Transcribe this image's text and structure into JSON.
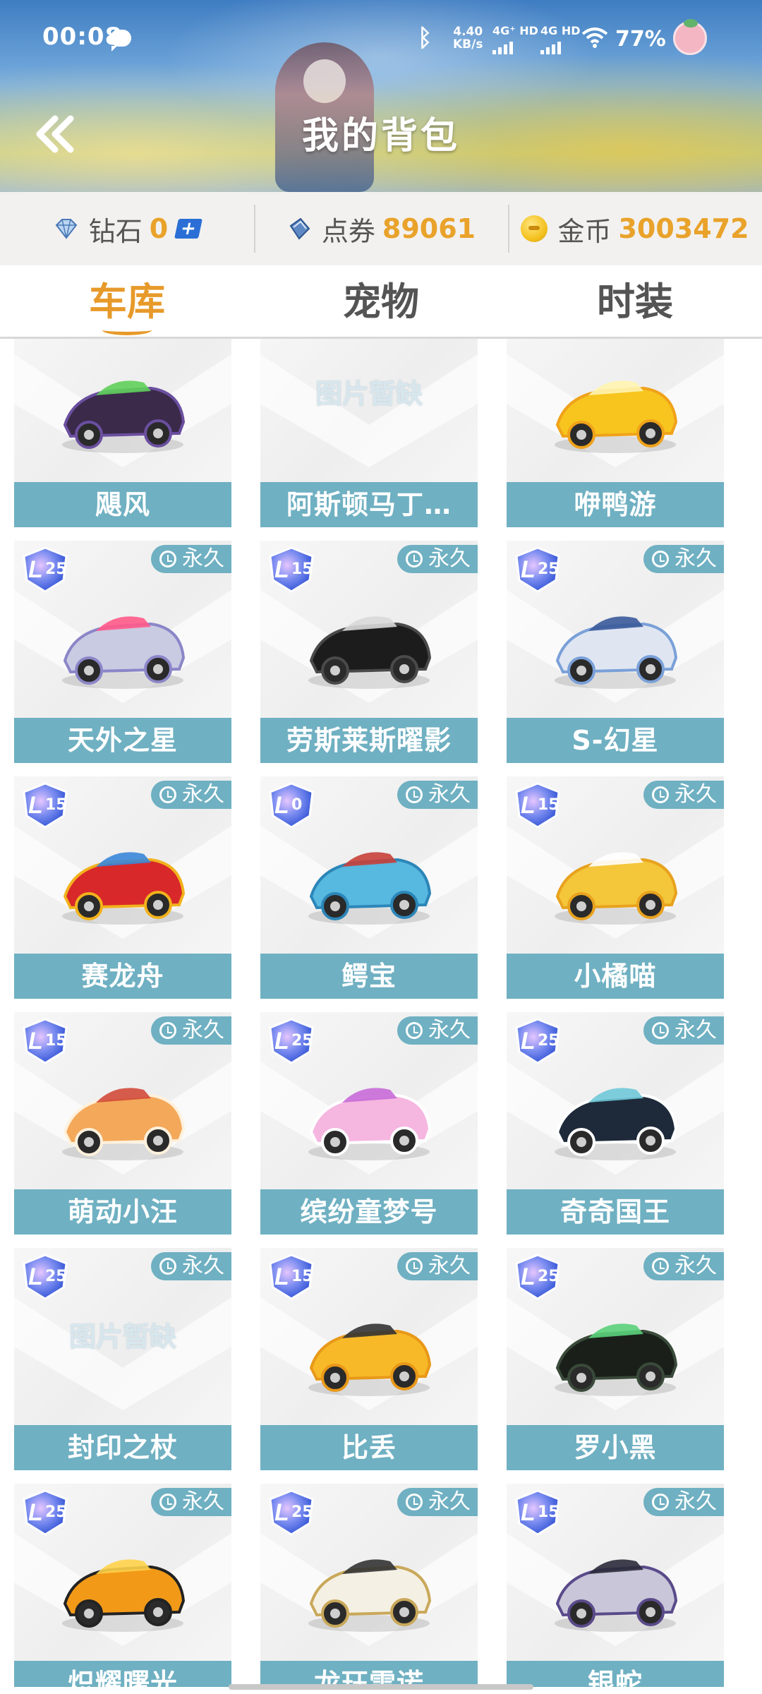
{
  "status_bar": {
    "time": "00:08",
    "net_speed_value": "4.40",
    "net_speed_unit": "KB/s",
    "sim1_label": "4G⁺ HD",
    "sim2_label": "4G HD",
    "battery": "77%"
  },
  "header": {
    "title": "我的背包"
  },
  "currency": {
    "diamond_label": "钻石",
    "diamond_value": "0",
    "voucher_label": "点券",
    "voucher_value": "89061",
    "coin_label": "金币",
    "coin_value": "3003472"
  },
  "tabs": [
    {
      "label": "车库",
      "active": true
    },
    {
      "label": "宠物",
      "active": false
    },
    {
      "label": "时装",
      "active": false
    }
  ],
  "accent_colors": {
    "tab_active": "#e79a2a",
    "card_label_bg": "#6fb0c2",
    "currency_value": "#e9a22a"
  },
  "items": [
    {
      "name": "飓风",
      "level": "",
      "tag": "",
      "image": "purple-green-kart",
      "missing_text": ""
    },
    {
      "name": "阿斯顿马丁…",
      "level": "",
      "tag": "",
      "image": "",
      "missing_text": "图片暂缺"
    },
    {
      "name": "咿鸭游",
      "level": "",
      "tag": "",
      "image": "yellow-duck-kart",
      "missing_text": ""
    },
    {
      "name": "天外之星",
      "level": "25",
      "tag": "永久",
      "image": "silver-star-kart",
      "missing_text": ""
    },
    {
      "name": "劳斯莱斯曜影",
      "level": "15",
      "tag": "永久",
      "image": "black-convertible",
      "missing_text": ""
    },
    {
      "name": "S-幻星",
      "level": "25",
      "tag": "永久",
      "image": "silver-jet-kart",
      "missing_text": ""
    },
    {
      "name": "赛龙舟",
      "level": "15",
      "tag": "永久",
      "image": "red-dragon-boat-kart",
      "missing_text": ""
    },
    {
      "name": "鳄宝",
      "level": "0",
      "tag": "永久",
      "image": "blue-croc-bike",
      "missing_text": ""
    },
    {
      "name": "小橘喵",
      "level": "15",
      "tag": "永久",
      "image": "yellow-cat-car",
      "missing_text": ""
    },
    {
      "name": "萌动小汪",
      "level": "15",
      "tag": "永久",
      "image": "shiba-dog-kart",
      "missing_text": ""
    },
    {
      "name": "缤纷童梦号",
      "level": "25",
      "tag": "永久",
      "image": "pink-dream-kart",
      "missing_text": ""
    },
    {
      "name": "奇奇国王",
      "level": "25",
      "tag": "永久",
      "image": "black-white-king-kart",
      "missing_text": ""
    },
    {
      "name": "封印之杖",
      "level": "25",
      "tag": "永久",
      "image": "",
      "missing_text": "图片暂缺"
    },
    {
      "name": "比丢",
      "level": "15",
      "tag": "永久",
      "image": "yellow-bidiu-car",
      "missing_text": ""
    },
    {
      "name": "罗小黑",
      "level": "25",
      "tag": "永久",
      "image": "black-cat-kart",
      "missing_text": ""
    },
    {
      "name": "炽耀曙光",
      "level": "25",
      "tag": "永久",
      "image": "orange-black-kart",
      "missing_text": ""
    },
    {
      "name": "龙珏雷诺",
      "level": "25",
      "tag": "永久",
      "image": "white-gold-buggy",
      "missing_text": ""
    },
    {
      "name": "银蛇",
      "level": "15",
      "tag": "永久",
      "image": "silver-purple-kart",
      "missing_text": ""
    }
  ]
}
